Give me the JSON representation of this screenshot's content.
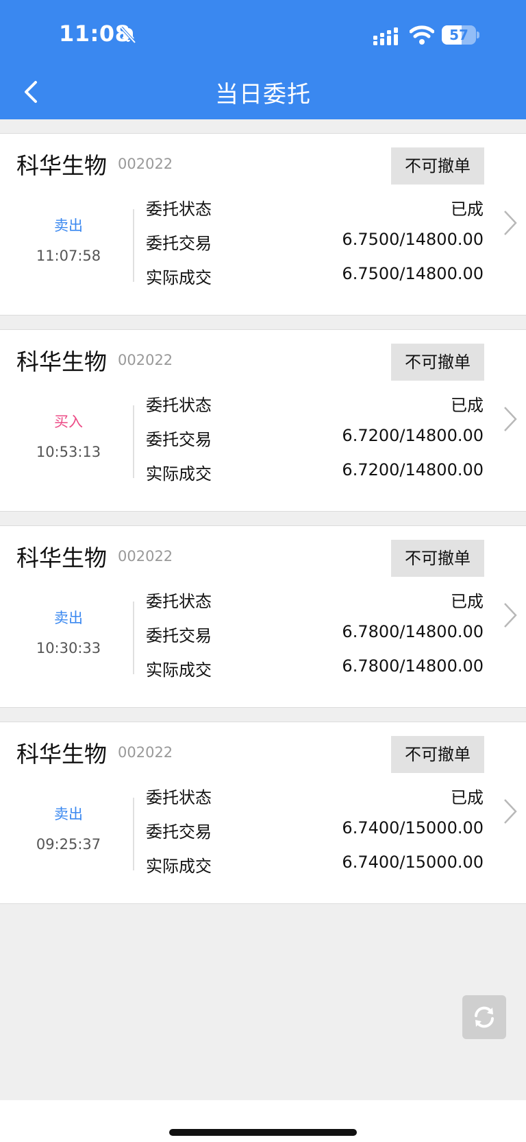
{
  "status_bar": {
    "time": "11:08",
    "battery": "57",
    "battery_level": 0.57
  },
  "nav": {
    "title": "当日委托"
  },
  "labels": {
    "status": "委托状态",
    "order": "委托交易",
    "actual": "实际成交",
    "cancel": "不可撤单"
  },
  "orders": [
    {
      "name": "科华生物",
      "code": "002022",
      "side": "卖出",
      "time": "11:07:58",
      "status": "已成",
      "order": "6.7500/14800.00",
      "actual": "6.7500/14800.00"
    },
    {
      "name": "科华生物",
      "code": "002022",
      "side": "买入",
      "time": "10:53:13",
      "status": "已成",
      "order": "6.7200/14800.00",
      "actual": "6.7200/14800.00"
    },
    {
      "name": "科华生物",
      "code": "002022",
      "side": "卖出",
      "time": "10:30:33",
      "status": "已成",
      "order": "6.7800/14800.00",
      "actual": "6.7800/14800.00"
    },
    {
      "name": "科华生物",
      "code": "002022",
      "side": "卖出",
      "time": "09:25:37",
      "status": "已成",
      "order": "6.7400/15000.00",
      "actual": "6.7400/15000.00"
    }
  ],
  "icons": {
    "back": "chevron-left-icon",
    "row_arrow": "chevron-right-icon",
    "refresh": "refresh-icon"
  },
  "colors": {
    "header": "#3a88f0",
    "sell": "#3a88f0",
    "buy": "#ec4b86"
  }
}
